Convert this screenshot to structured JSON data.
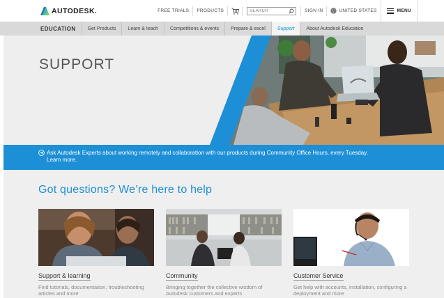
{
  "brand": {
    "name": "AUTODESK.",
    "accent": "#1d8fd6"
  },
  "topnav": {
    "free_trials": "FREE TRIALS",
    "products": "PRODUCTS",
    "search_placeholder": "SEARCH",
    "sign_in": "SIGN IN",
    "region": "UNITED STATES",
    "menu": "MENU"
  },
  "subnav": {
    "home": "EDUCATION",
    "items": [
      {
        "label": "Get Products"
      },
      {
        "label": "Learn & teach"
      },
      {
        "label": "Competitions & events"
      },
      {
        "label": "Prepare & excel"
      },
      {
        "label": "Support"
      },
      {
        "label": "About Autodesk Education"
      }
    ]
  },
  "hero": {
    "title": "SUPPORT"
  },
  "banner": {
    "message": "Ask Autodesk Experts about working remotely and collaboration with our products during Community Office Hours, every Tuesday.",
    "link": "Learn more."
  },
  "support": {
    "heading": "Got questions? We’re here to help",
    "cards": [
      {
        "title": "Support & learning",
        "desc": "Find tutorials, documentation, troubleshooting articles and more"
      },
      {
        "title": "Community",
        "desc": "Bringing together the collective wisdom of Autodesk customers and experts"
      },
      {
        "title": "Customer Service",
        "desc": "Get help with accounts, installation, configuring a deployment and more"
      }
    ]
  }
}
